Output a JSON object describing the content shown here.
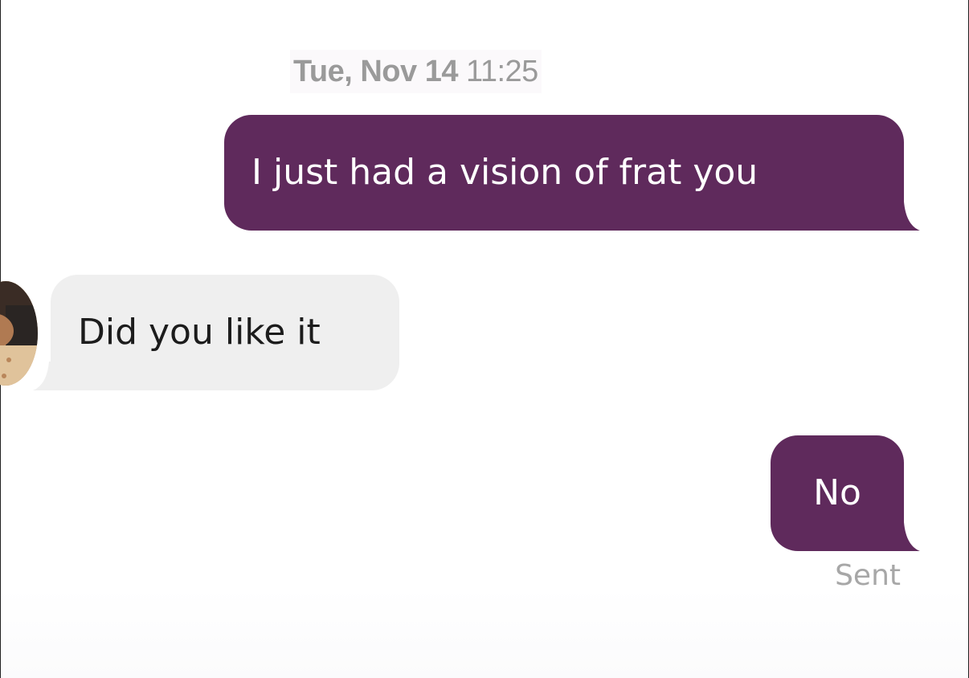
{
  "conversation": {
    "timestamp": {
      "date": "Tue, Nov 14",
      "time": "11:25"
    },
    "messages": [
      {
        "direction": "outgoing",
        "text": "I just had a vision of frat you"
      },
      {
        "direction": "incoming",
        "text": "Did you like it"
      },
      {
        "direction": "outgoing",
        "text": "No"
      }
    ],
    "delivery_status": "Sent"
  },
  "contact": {
    "avatar_icon": "user-avatar"
  },
  "colors": {
    "outgoing_bubble": "#5f2a5c",
    "incoming_bubble": "#efefef",
    "timestamp_text": "#9a9a9a",
    "status_text": "#a7a7a7"
  }
}
